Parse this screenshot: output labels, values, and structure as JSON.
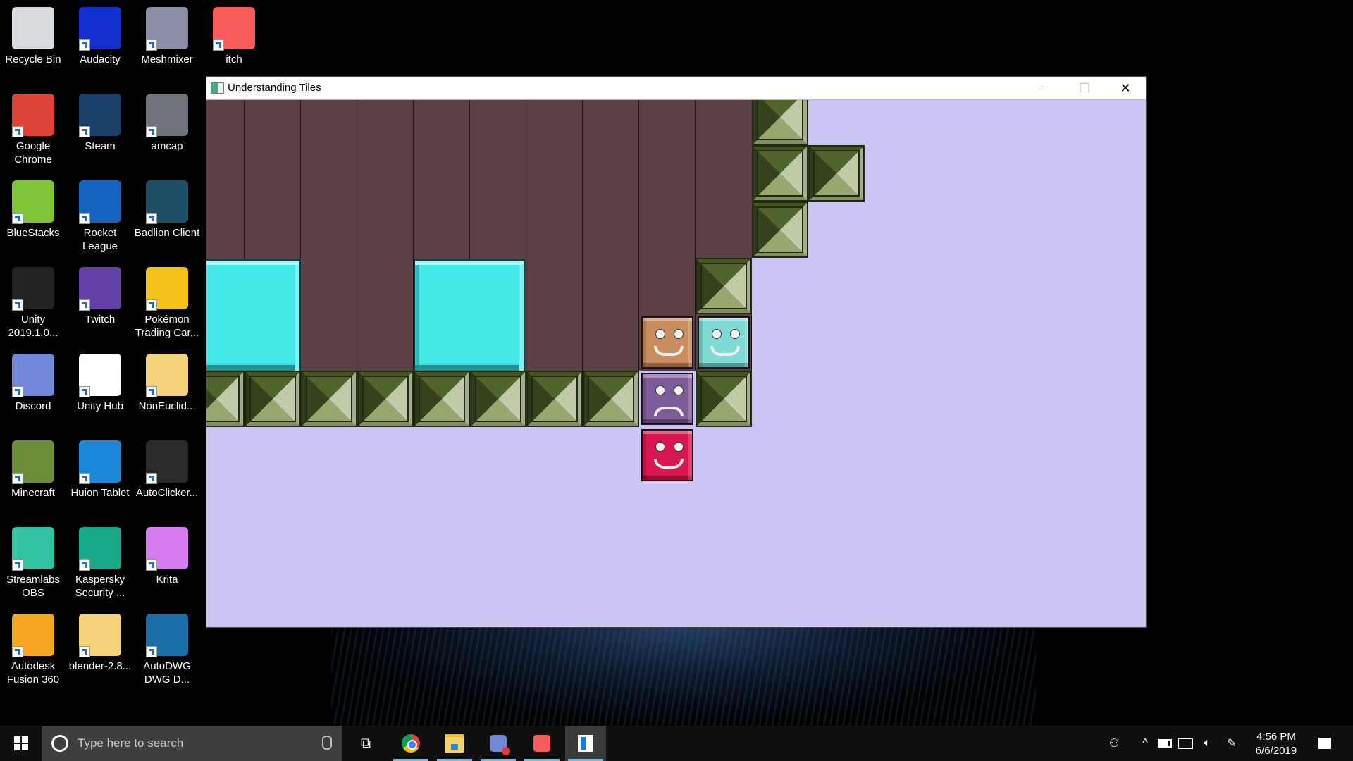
{
  "desktop": {
    "icons": [
      {
        "label": "Recycle Bin",
        "icon": "recycle-bin-icon",
        "color": "#d9dde2"
      },
      {
        "label": "Audacity",
        "icon": "audacity-icon",
        "color": "#1530d0"
      },
      {
        "label": "Meshmixer",
        "icon": "meshmixer-icon",
        "color": "#8b8fa8"
      },
      {
        "label": "itch",
        "icon": "itch-icon",
        "color": "#fa5c5c"
      },
      {
        "label": "Google Chrome",
        "icon": "chrome-icon",
        "color": "#db4437"
      },
      {
        "label": "Steam",
        "icon": "steam-icon",
        "color": "#1b3f6b"
      },
      {
        "label": "amcap",
        "icon": "camera-icon",
        "color": "#6f747c"
      },
      {
        "label": "BlueStacks",
        "icon": "bluestacks-icon",
        "color": "#7fc437"
      },
      {
        "label": "Rocket League",
        "icon": "rocket-league-icon",
        "color": "#1565c0"
      },
      {
        "label": "Badlion Client",
        "icon": "badlion-icon",
        "color": "#1f4f66"
      },
      {
        "label": "Unity 2019.1.0...",
        "icon": "unity-icon",
        "color": "#222222"
      },
      {
        "label": "Twitch",
        "icon": "twitch-icon",
        "color": "#6441a4"
      },
      {
        "label": "Pokémon Trading Car...",
        "icon": "pokemon-tcg-icon",
        "color": "#f2c21b"
      },
      {
        "label": "Discord",
        "icon": "discord-icon",
        "color": "#7289da"
      },
      {
        "label": "Unity Hub",
        "icon": "unity-hub-icon",
        "color": "#ffffff"
      },
      {
        "label": "NonEuclid...",
        "icon": "folder-icon",
        "color": "#f4d27a"
      },
      {
        "label": "Minecraft",
        "icon": "minecraft-icon",
        "color": "#6c8e3c"
      },
      {
        "label": "Huion Tablet",
        "icon": "huion-icon",
        "color": "#1e88d8"
      },
      {
        "label": "AutoClicker...",
        "icon": "mouse-icon",
        "color": "#2a2a2a"
      },
      {
        "label": "Streamlabs OBS",
        "icon": "streamlabs-icon",
        "color": "#31c3a2"
      },
      {
        "label": "Kaspersky Security ...",
        "icon": "kaspersky-icon",
        "color": "#1aa88b"
      },
      {
        "label": "Krita",
        "icon": "krita-icon",
        "color": "#d67cf0"
      },
      {
        "label": "Autodesk Fusion 360",
        "icon": "fusion360-icon",
        "color": "#f5a623"
      },
      {
        "label": "blender-2.8...",
        "icon": "folder-icon",
        "color": "#f4d27a"
      },
      {
        "label": "AutoDWG DWG D...",
        "icon": "autodwg-icon",
        "color": "#1b6fa8"
      }
    ]
  },
  "window": {
    "title": "Understanding Tiles",
    "minimize": "—",
    "maximize": "☐",
    "close": "✕"
  },
  "game": {
    "colors": {
      "sky": "#cbc5f3",
      "wall": "#5b3f45",
      "cyan": "#44e8e9"
    },
    "faces": [
      {
        "name": "brown-face-block",
        "color": "#c98d60",
        "expression": "smile"
      },
      {
        "name": "teal-face-block",
        "color": "#7fdad6",
        "expression": "smile"
      },
      {
        "name": "purple-face-block",
        "color": "#7d5a9a",
        "expression": "frown"
      },
      {
        "name": "red-face-block",
        "color": "#d8164f",
        "expression": "smile"
      }
    ]
  },
  "taskbar": {
    "search_placeholder": "Type here to search",
    "apps": [
      {
        "name": "task-view",
        "glyph": "⧉"
      },
      {
        "name": "chrome",
        "glyph": "●"
      },
      {
        "name": "file-explorer",
        "glyph": "▬"
      },
      {
        "name": "discord",
        "glyph": "●"
      },
      {
        "name": "itch",
        "glyph": "■"
      },
      {
        "name": "understanding-tiles",
        "glyph": "▮"
      }
    ],
    "time": "4:56 PM",
    "date": "6/6/2019"
  }
}
